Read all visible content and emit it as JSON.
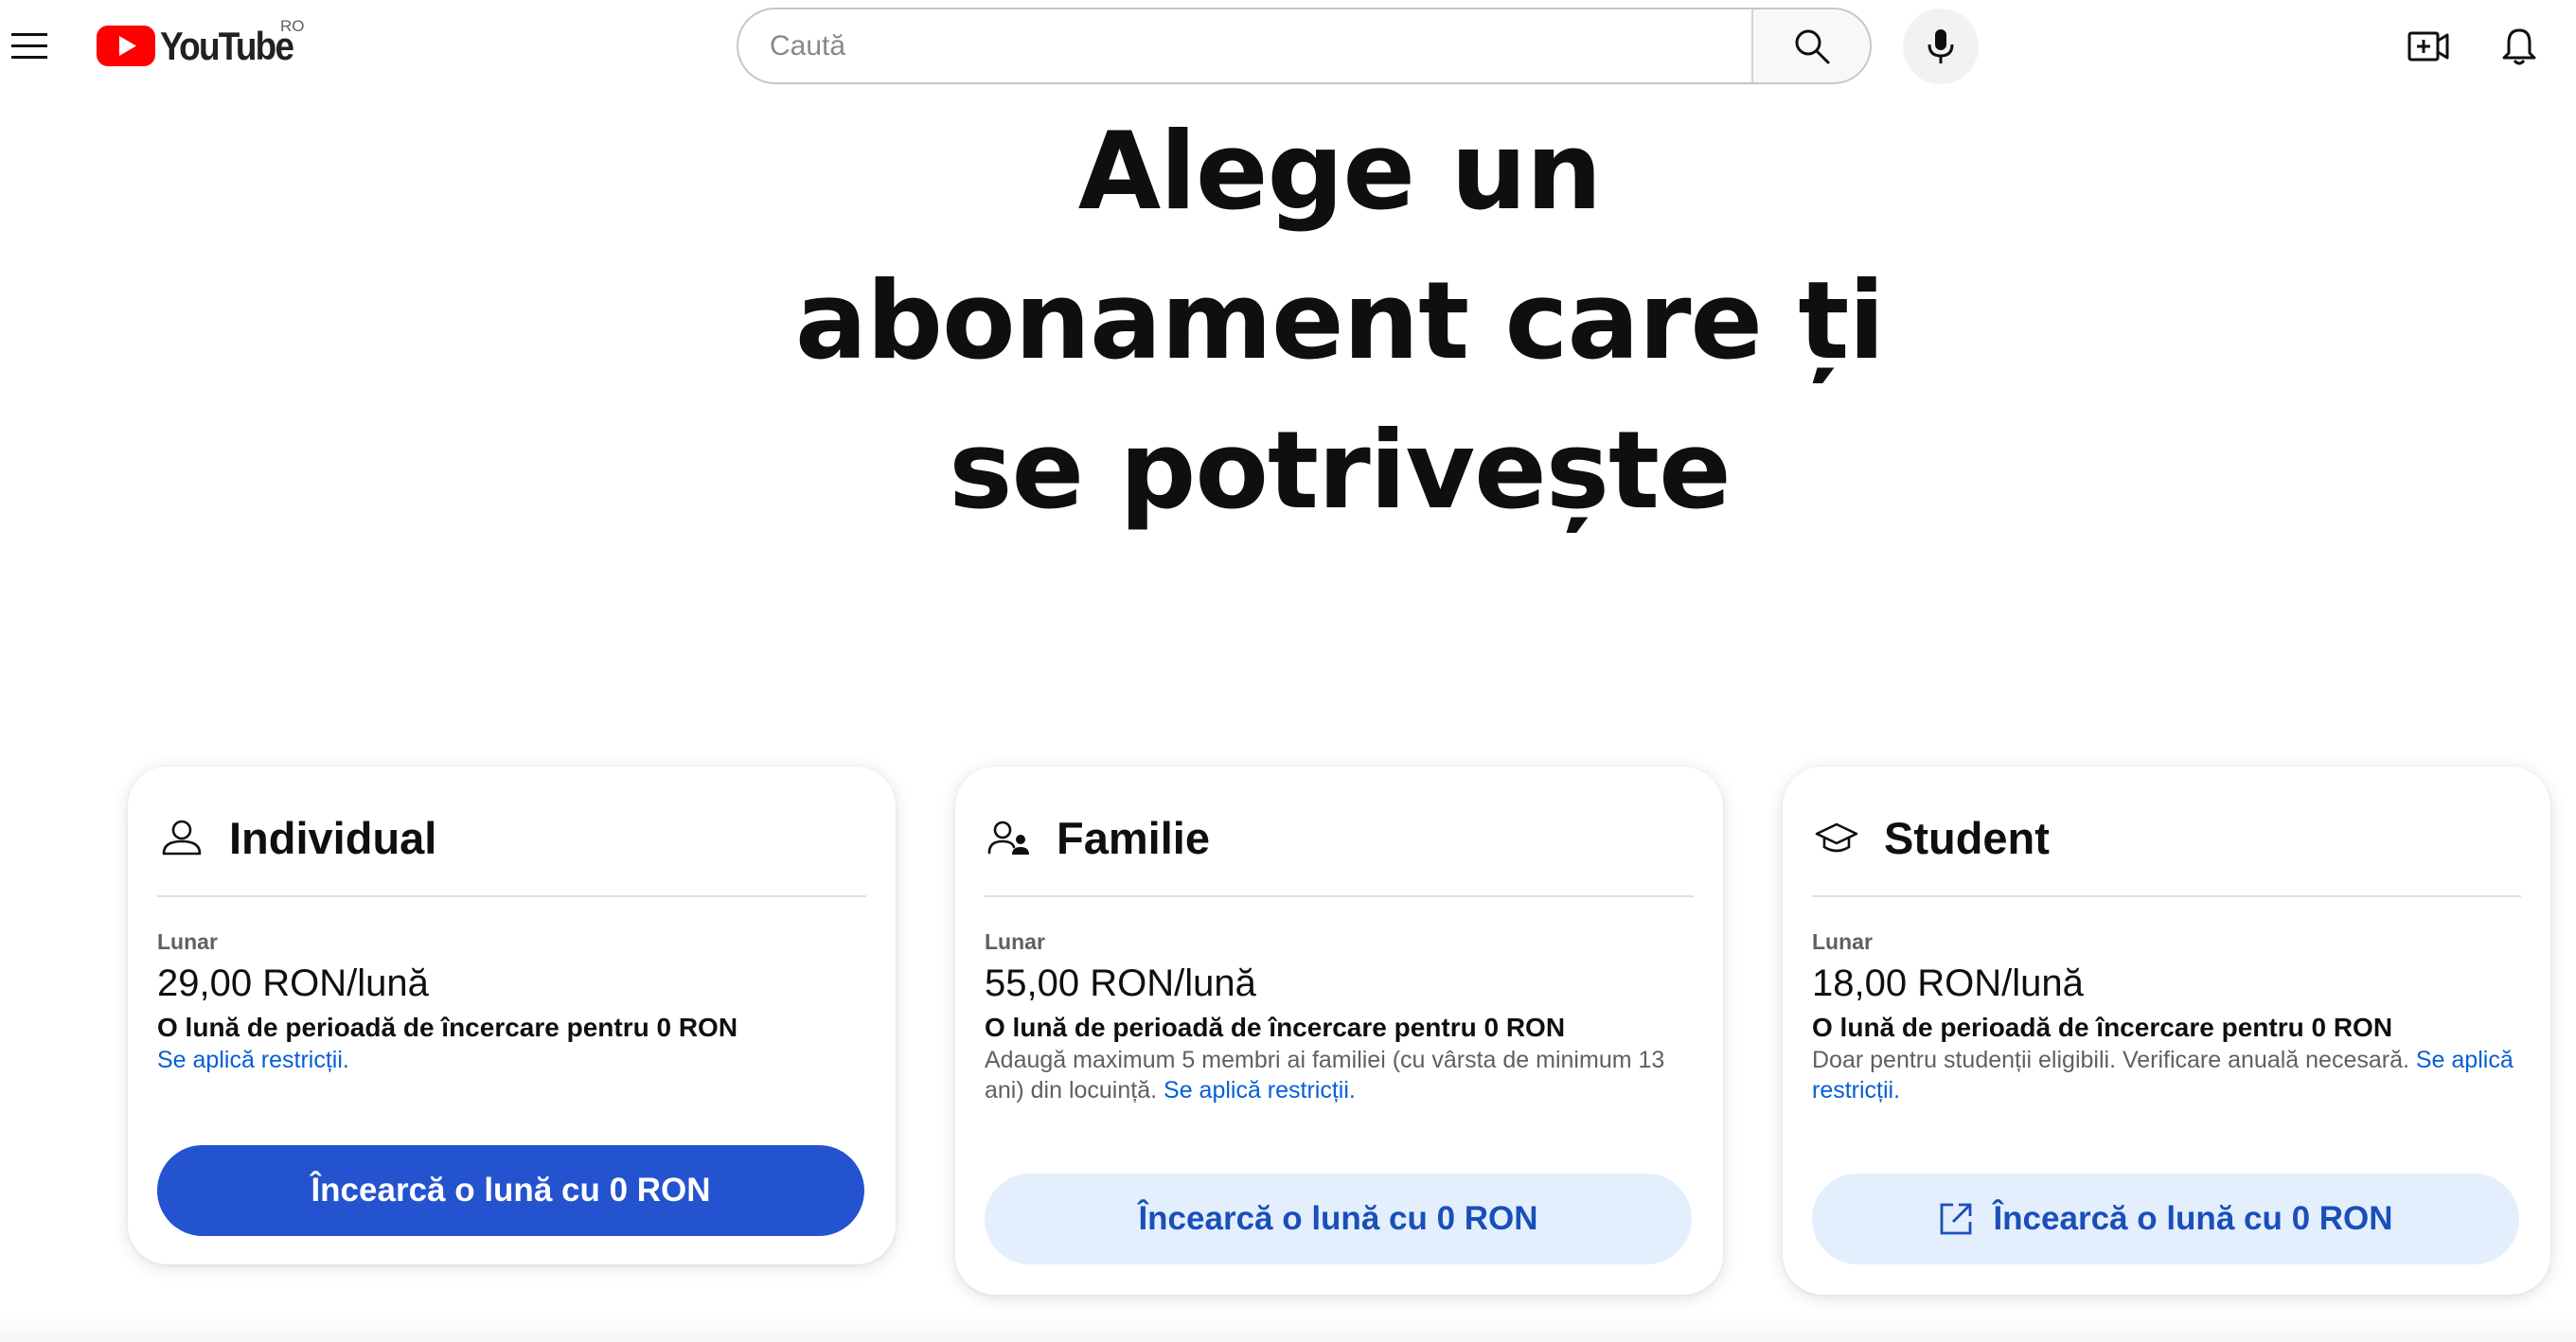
{
  "header": {
    "logo_text": "YouTube",
    "region": "RO",
    "search": {
      "placeholder": "Caută",
      "value": ""
    },
    "icons": {
      "menu": "hamburger-menu-icon",
      "search": "search-icon",
      "mic": "microphone-icon",
      "create": "create-video-icon",
      "notifications": "bell-icon"
    }
  },
  "hero": {
    "title_line1": "Alege un",
    "title_line2": "abonament care ți",
    "title_line3": "se potrivește"
  },
  "plans": [
    {
      "name": "Individual",
      "icon": "person-icon",
      "billing": "Lunar",
      "price": "29,00 RON/lună",
      "trial": "O lună de perioadă de încercare pentru 0 RON",
      "description": "",
      "restrictions_link": "Se aplică restricții.",
      "cta": "Încearcă o lună cu 0 RON",
      "cta_style": "primary"
    },
    {
      "name": "Familie",
      "icon": "family-icon",
      "billing": "Lunar",
      "price": "55,00 RON/lună",
      "trial": "O lună de perioadă de încercare pentru 0 RON",
      "description": "Adaugă maximum 5 membri ai familiei (cu vârsta de minimum 13 ani) din locuință.",
      "restrictions_link": "Se aplică restricții.",
      "cta": "Încearcă o lună cu 0 RON",
      "cta_style": "secondary"
    },
    {
      "name": "Student",
      "icon": "graduation-cap-icon",
      "billing": "Lunar",
      "price": "18,00 RON/lună",
      "trial": "O lună de perioadă de încercare pentru 0 RON",
      "description": "Doar pentru studenții eligibili. Verificare anuală necesară.",
      "restrictions_link": "Se aplică restricții.",
      "cta": "Încearcă o lună cu 0 RON",
      "cta_style": "secondary",
      "cta_icon": "external-link-icon"
    }
  ],
  "colors": {
    "brand_red": "#ff0000",
    "primary_button": "#2453cf",
    "secondary_button_bg": "#e3effd",
    "secondary_button_text": "#1a4fba",
    "link": "#065fd4"
  }
}
